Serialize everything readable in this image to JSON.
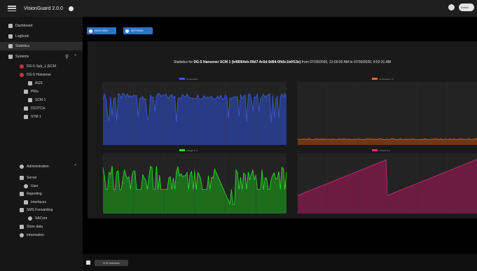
{
  "app": {
    "title": "VisionGuard 2.0.0",
    "user_pill": "Admin"
  },
  "sidebar": {
    "items": [
      {
        "label": "Dashboard"
      },
      {
        "label": "Logbook"
      },
      {
        "label": "Statistics"
      },
      {
        "label": "Systems"
      }
    ],
    "tree": [
      {
        "label": "DG-5 Sub_1 (ECM"
      },
      {
        "label": "DG-5 Hansener"
      },
      {
        "label": "AGS"
      },
      {
        "label": "PRIs"
      },
      {
        "label": "SCM 1"
      },
      {
        "label": "DCI/TCIs"
      },
      {
        "label": "STM 1"
      }
    ],
    "admin": {
      "label": "Administration"
    },
    "admin_items": [
      {
        "label": "Server"
      },
      {
        "label": "User"
      },
      {
        "label": "Reporting"
      },
      {
        "label": "Interfaces"
      },
      {
        "label": "SMS Forwarding"
      },
      {
        "label": "SACom"
      },
      {
        "label": "Store data"
      },
      {
        "label": "Information"
      }
    ]
  },
  "toolbar": {
    "btn1": "DATA VIEW",
    "btn2": "SETTINGS"
  },
  "stats": {
    "title_prefix": "Statistics for",
    "title_device": "DG-5 Hansener SCM 1 (b48064eb-09d7-4c6d-9d84-0fb5c1b0f13e)",
    "title_suffix": "from 07/29/2020, 12:00:00 AM to 07/30/2020, 9:52:31 AM"
  },
  "charts": [
    {
      "name": "Temperature",
      "color": "#3d5bd9",
      "fill": "#2b3f96"
    },
    {
      "name": "Temperature °C",
      "color": "#d96a2b",
      "fill": "#7c3a14"
    },
    {
      "name": "Voltage in V",
      "color": "#2ee02e",
      "fill": "#1c7a1c"
    },
    {
      "name": "Current in A",
      "color": "#d42f7a",
      "fill": "#7a1a47"
    }
  ],
  "footer": {
    "tab": "SCM Interfaces"
  }
}
